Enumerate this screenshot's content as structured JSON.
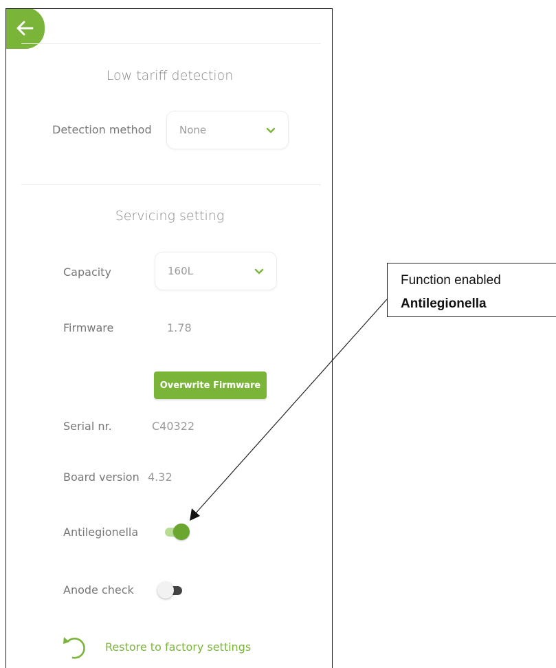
{
  "back_button": {
    "icon": "arrow-left-icon"
  },
  "low_tariff": {
    "title": "Low tariff detection",
    "detection_label": "Detection method",
    "detection_value": "None"
  },
  "servicing": {
    "title": "Servicing setting",
    "capacity_label": "Capacity",
    "capacity_value": "160L",
    "firmware_label": "Firmware",
    "firmware_value": "1.78",
    "overwrite_button": "Overwrite Firmware",
    "serial_label": "Serial nr.",
    "serial_value": "C40322",
    "board_label": "Board version",
    "board_value": "4.32",
    "antilegionella_label": "Antilegionella",
    "antilegionella_on": true,
    "anode_label": "Anode check",
    "anode_on": false
  },
  "restore": {
    "label": "Restore to factory settings",
    "icon": "undo-icon"
  },
  "callout": {
    "line1": "Function  enabled",
    "line2": "Antilegionella"
  },
  "colors": {
    "accent": "#7ab53a",
    "toggle_track_on": "#b9dc95",
    "toggle_off_knob": "#f2f2f2",
    "toggle_off_track": "#444444"
  }
}
